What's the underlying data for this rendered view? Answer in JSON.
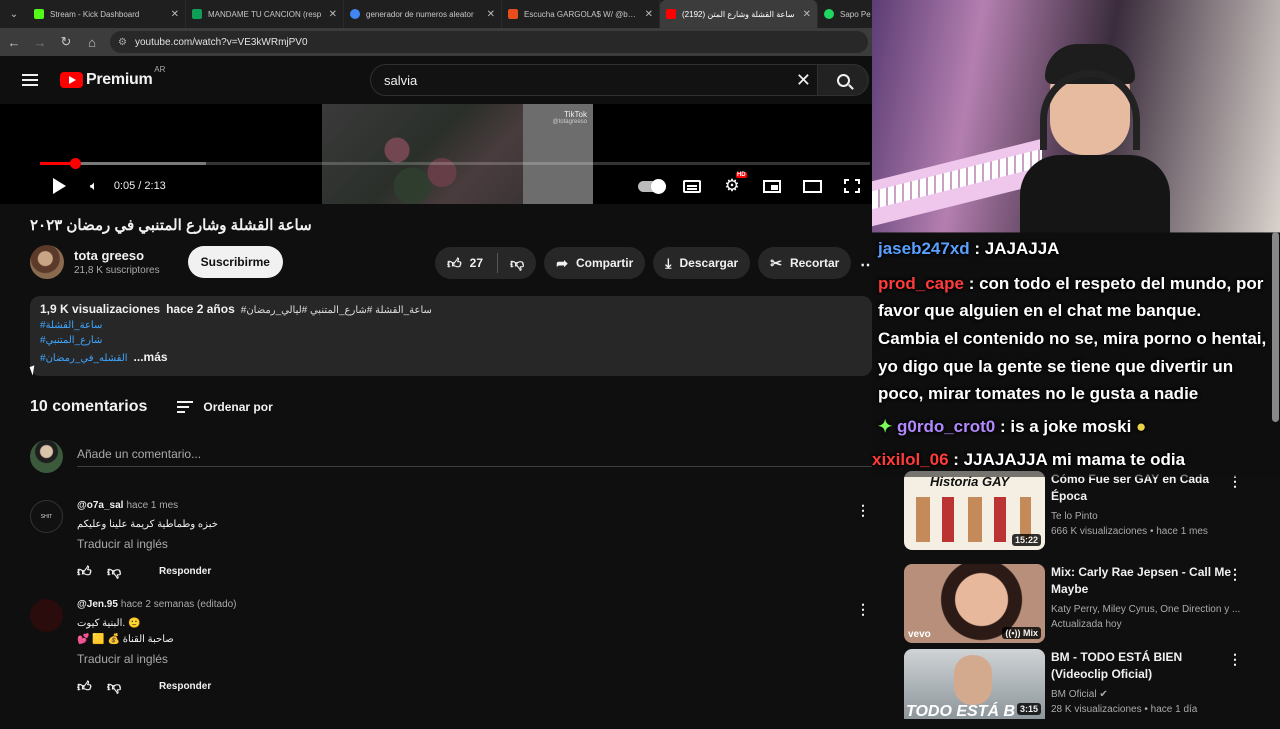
{
  "browser": {
    "tabs": [
      {
        "title": "Stream - Kick Dashboard",
        "color": "#53fc18"
      },
      {
        "title": "MANDAME TU CANCION (resp",
        "color": "#0f9d58"
      },
      {
        "title": "generador de numeros aleator",
        "color": "#4285f4"
      },
      {
        "title": "Escucha GARGOLA$ W/ @bby.r",
        "color": "#e84e1b"
      },
      {
        "title": "ساعة القشلة وشارع المتن (2192)",
        "color": "#ff0000",
        "active": true
      },
      {
        "title": "Sapo Pe",
        "color": "#1ed760"
      }
    ],
    "url": "youtube.com/watch?v=VE3kWRmjPV0"
  },
  "header": {
    "brand": "Premium",
    "country": "AR",
    "search_value": "salvia"
  },
  "player": {
    "time": "0:05 / 2:13",
    "progress_played": 0.042,
    "progress_buffered": 0.2,
    "tiktok_label": "TikTok",
    "tiktok_handle": "@totagreeso",
    "hd_badge": "HD"
  },
  "video": {
    "title": "ساعة القشلة وشارع المتنبي في رمضان ٢٠٢٣",
    "channel": "tota greeso",
    "subscribers": "21,8 K suscriptores",
    "subscribe_label": "Suscribirme",
    "likes": "27",
    "share_label": "Compartir",
    "download_label": "Descargar",
    "clip_label": "Recortar"
  },
  "description": {
    "views": "1,9 K visualizaciones",
    "age": "hace 2 años",
    "tags_inline": "#ساعة_القشلة #شارع_المتنبي #ليالي_رمضان",
    "link1": "#ساعة_القشلة",
    "link2": "#شارع_المتنبي",
    "link3": "#القشله_في_رمضان",
    "more": "...más"
  },
  "comments": {
    "count": "10 comentarios",
    "sort_label": "Ordenar por",
    "add_placeholder": "Añade un comentario...",
    "translate_label": "Traducir al inglés",
    "reply_label": "Responder",
    "items": [
      {
        "author": "@o7a_sal",
        "time": "hace 1 mes",
        "text": "خبزه وطماطية كريمة علينا وعليكم",
        "avatar_label": "SHIT"
      },
      {
        "author": "@Jen.95",
        "time": "hace 2 semanas (editado)",
        "line1": "البنية كيوت. 🙂",
        "line2": "💕 🟨 💰 صاحبة القناة"
      }
    ]
  },
  "chat": [
    {
      "user": "jaseb247xd",
      "user_color": "#5aa0ff",
      "msg": "JAJAJJA"
    },
    {
      "user": "prod_cape",
      "user_color": "#ff3b3b",
      "msg": "con todo el respeto del mundo, por"
    },
    {
      "user": "",
      "user_color": "#fff",
      "msg": "favor que alguien en el chat me banque."
    },
    {
      "user": "",
      "user_color": "#fff",
      "msg": "Cambia el contenido no se, mira porno o hentai,"
    },
    {
      "user": "",
      "user_color": "#fff",
      "msg": "yo digo que la gente se tiene que divertir un"
    },
    {
      "user": "",
      "user_color": "#fff",
      "msg": "poco, mirar tomates no le gusta a nadie"
    },
    {
      "user": "g0rdo_crot0",
      "user_color": "#b388ff",
      "msg": "is a joke moski"
    },
    {
      "user": "xixilol_06",
      "user_color": "#ff3b3b",
      "msg": "JJAJAJJA mi mama te odia"
    }
  ],
  "recommendations": [
    {
      "title": "Cómo Fue ser GAY en Cada Época",
      "channel": "Te lo Pinto",
      "meta": "666 K visualizaciones • hace 1 mes",
      "duration": "15:22",
      "thumb_text": "Historia GAY"
    },
    {
      "title": "Mix: Carly Rae Jepsen - Call Me Maybe",
      "channel": "Katy Perry, Miley Cyrus, One Direction y ...",
      "meta": "Actualizada hoy",
      "duration": "Mix",
      "thumb_text": "vevo"
    },
    {
      "title": "BM - TODO ESTÁ BIEN (Videoclip Oficial)",
      "channel": "BM Oficial",
      "meta": "28 K visualizaciones • hace 1 día",
      "duration": "3:15",
      "thumb_text": "TODO ESTÁ B"
    }
  ]
}
